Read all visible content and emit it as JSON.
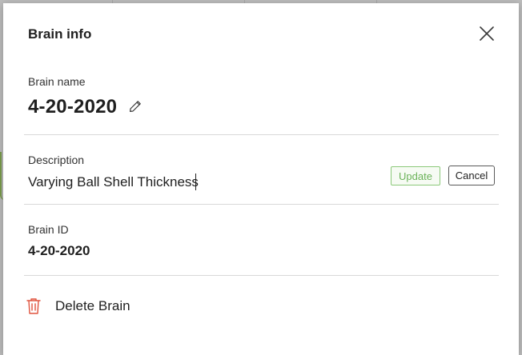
{
  "dialog": {
    "title": "Brain info",
    "close_icon": "close-icon"
  },
  "brain_name": {
    "label": "Brain name",
    "value": "4-20-2020",
    "edit_icon": "pencil-icon"
  },
  "description": {
    "label": "Description",
    "value": "Varying Ball Shell Thickness",
    "update_label": "Update",
    "cancel_label": "Cancel"
  },
  "brain_id": {
    "label": "Brain ID",
    "value": "4-20-2020"
  },
  "delete": {
    "label": "Delete Brain",
    "icon": "trash-icon",
    "icon_color": "#e0533e"
  },
  "colors": {
    "update_accent": "#6cb35a",
    "update_border": "#8cc97a"
  }
}
